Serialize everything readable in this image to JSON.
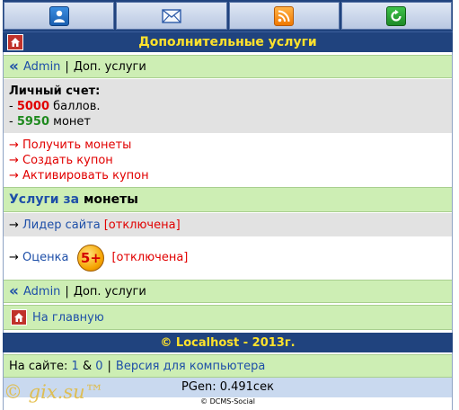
{
  "topbar": {
    "icons": [
      "user-icon",
      "mail-icon",
      "rss-icon",
      "refresh-icon"
    ]
  },
  "title": "Дополнительные услуги",
  "breadcrumb": {
    "user": "Admin",
    "separator": "|",
    "current": "Доп. услуги"
  },
  "account": {
    "heading": "Личный счет:",
    "points_value": "5000",
    "points_unit": "баллов.",
    "coins_value": "5950",
    "coins_unit": "монет",
    "prefix": "- "
  },
  "actions": [
    "→ Получить монеты",
    "→ Создать купон",
    "→ Активировать купон"
  ],
  "services_heading": {
    "part1": "Услуги за",
    "part2": "монеты"
  },
  "services": [
    {
      "label": "Лидер сайта",
      "status": "[отключена]"
    },
    {
      "label": "Оценка",
      "badge": "5+",
      "status": "[отключена]"
    }
  ],
  "home_link": "На главную",
  "footer": {
    "copyright": "© Localhost - 2013г.",
    "online_label": "На сайте:",
    "online_a": "1",
    "online_amp": "&",
    "online_b": "0",
    "online_sep": "|",
    "desktop_link": "Версия для компьютера",
    "pgen": "PGen: 0.491сек",
    "engine": "© DCMS-Social",
    "watermark": "© gix.su™"
  },
  "colors": {
    "header_bg": "#20437e",
    "title_text": "#ffe22c",
    "green_row": "#cdeeb4",
    "link_blue": "#1e4fa8",
    "link_red": "#e10000",
    "points_red": "#e10000",
    "coins_green": "#1f8a1f"
  }
}
